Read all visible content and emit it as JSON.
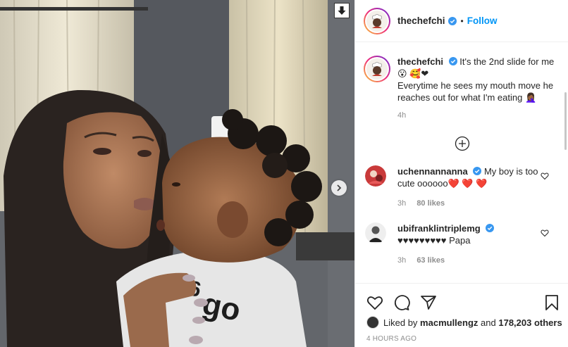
{
  "post": {
    "author": "thechefchi",
    "follow_label": "Follow",
    "separator": "•",
    "caption_line1": "It's the 2nd slide for me",
    "caption_emojis": "😮 🥰❤",
    "caption_line2": "Everytime he sees my mouth move he reaches out for what I'm eating 🤦🏾‍♀️",
    "caption_time": "4h",
    "load_more_icon": "plus-circle-icon"
  },
  "comments": [
    {
      "user": "uchennannanna",
      "text": "My boy is too cute oooooo❤️ ❤️ ❤️",
      "time": "3h",
      "likes": "80 likes"
    },
    {
      "user": "ubifranklintriplemg",
      "text": "♥♥♥♥♥♥♥♥♥ Papa",
      "time": "3h",
      "likes": "63 likes"
    }
  ],
  "likes": {
    "prefix": "Liked by",
    "user": "macmullengz",
    "middle": "and",
    "count": "178,203 others"
  },
  "posted_ago": "4 HOURS AGO",
  "colors": {
    "accent": "#0095f6",
    "verified": "#3897f0",
    "meta": "#8e8e8e"
  }
}
